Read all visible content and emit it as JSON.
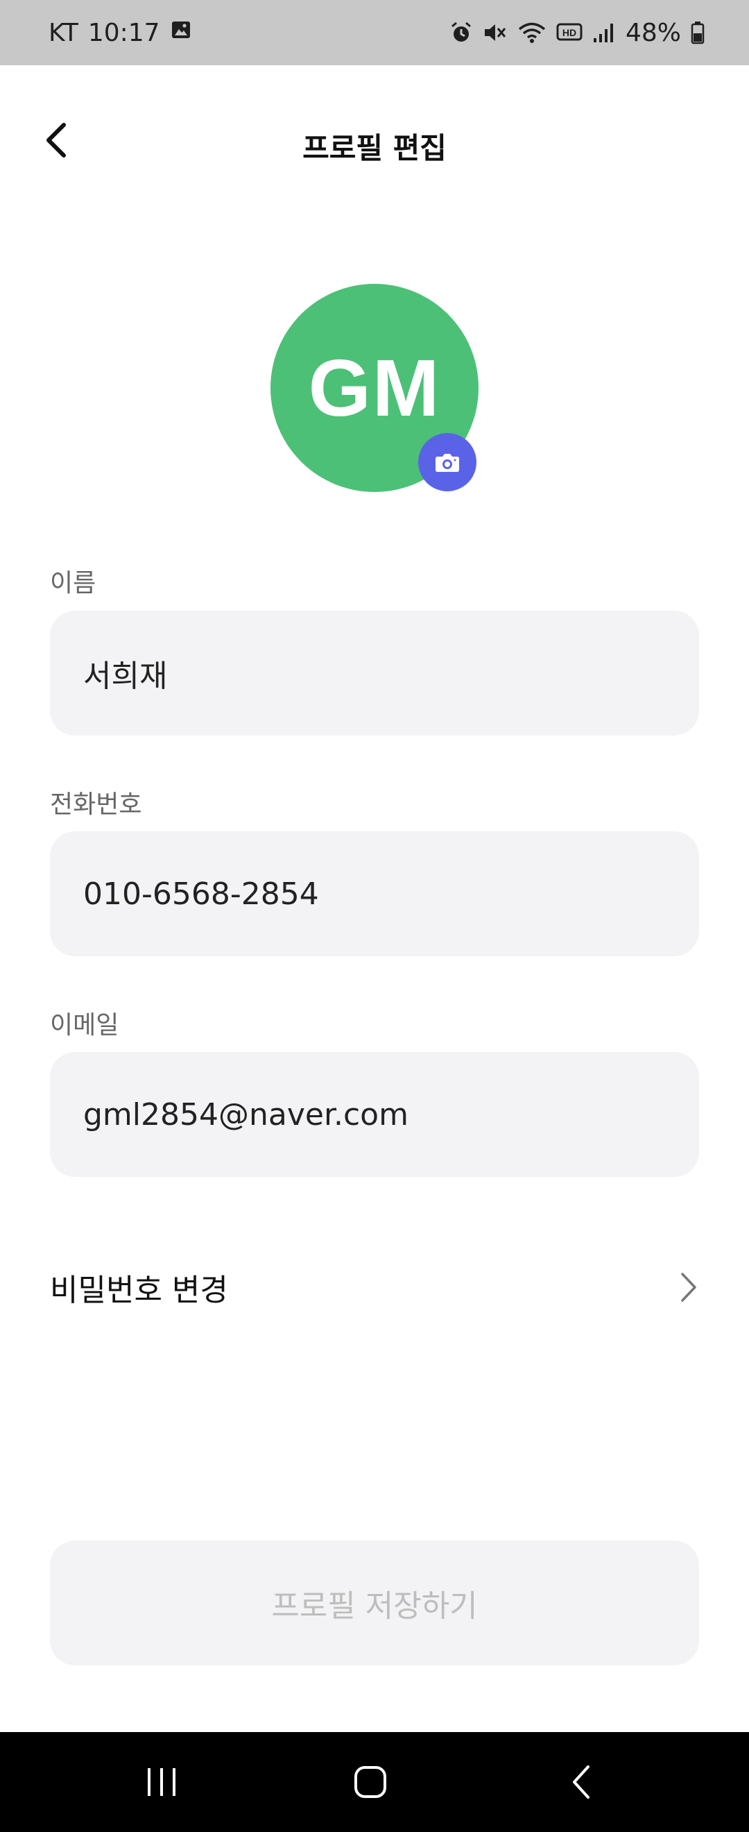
{
  "status_bar": {
    "carrier": "KT",
    "time": "10:17",
    "battery": "48%",
    "icons": [
      "gallery-icon",
      "alarm-icon",
      "mute-icon",
      "wifi-icon",
      "hd-icon",
      "signal-icon",
      "battery-icon"
    ]
  },
  "header": {
    "title": "프로필 편집",
    "back_icon": "back-arrow-icon"
  },
  "avatar": {
    "initials": "GM",
    "background_color": "#4cc077",
    "camera_badge_color": "#5a63e8",
    "camera_icon": "camera-icon"
  },
  "form": {
    "name": {
      "label": "이름",
      "value": "서희재"
    },
    "phone": {
      "label": "전화번호",
      "value": "010-6568-2854"
    },
    "email": {
      "label": "이메일",
      "value": "gml2854@naver.com"
    }
  },
  "password_change": {
    "label": "비밀번호 변경",
    "icon": "chevron-right-icon"
  },
  "save_button": {
    "label": "프로필 저장하기",
    "enabled": false
  },
  "nav_bar": {
    "buttons": [
      "recent-apps-icon",
      "home-icon",
      "back-icon"
    ]
  }
}
